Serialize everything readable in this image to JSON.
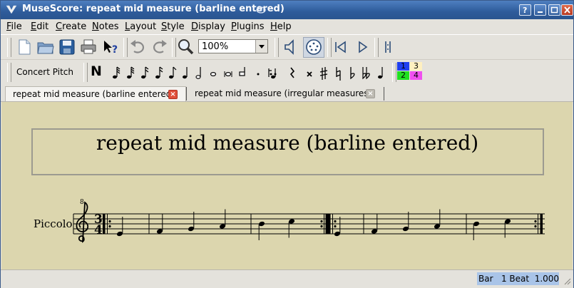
{
  "window": {
    "title": "MuseScore: repeat mid measure (barline entered)"
  },
  "menubar": {
    "items": [
      {
        "label": "File",
        "key": "F",
        "rest": "ile"
      },
      {
        "label": "Edit",
        "key": "E",
        "rest": "dit"
      },
      {
        "label": "Create",
        "key": "C",
        "rest": "reate"
      },
      {
        "label": "Notes",
        "key": "N",
        "rest": "otes"
      },
      {
        "label": "Layout",
        "key": "L",
        "rest": "ayout"
      },
      {
        "label": "Style",
        "key": "S",
        "rest": "tyle"
      },
      {
        "label": "Display",
        "key": "D",
        "rest": "isplay"
      },
      {
        "label": "Plugins",
        "key": "P",
        "rest": "lugins"
      },
      {
        "label": "Help",
        "key": "H",
        "rest": "elp"
      }
    ]
  },
  "toolbar": {
    "zoom_value": "100%",
    "concert_pitch_label": "Concert Pitch",
    "note_entry_label": "N",
    "voices": [
      "1",
      "2",
      "3",
      "4"
    ],
    "colors": {
      "voice1": "#1f3ff0",
      "voice2": "#20e020",
      "voice3": "#fff0c0",
      "voice4": "#f050f0"
    }
  },
  "tabs": [
    {
      "label": "repeat mid measure (barline entered)",
      "active": true
    },
    {
      "label": "repeat mid measure (irregular measures)",
      "active": false
    }
  ],
  "score": {
    "title": "repeat mid measure (barline entered)",
    "instrument": "Piccolo",
    "octave_mark": "8",
    "time_sig_top": "3",
    "time_sig_bottom": "4"
  },
  "statusbar": {
    "position": "Bar   1 Beat  1.000"
  }
}
